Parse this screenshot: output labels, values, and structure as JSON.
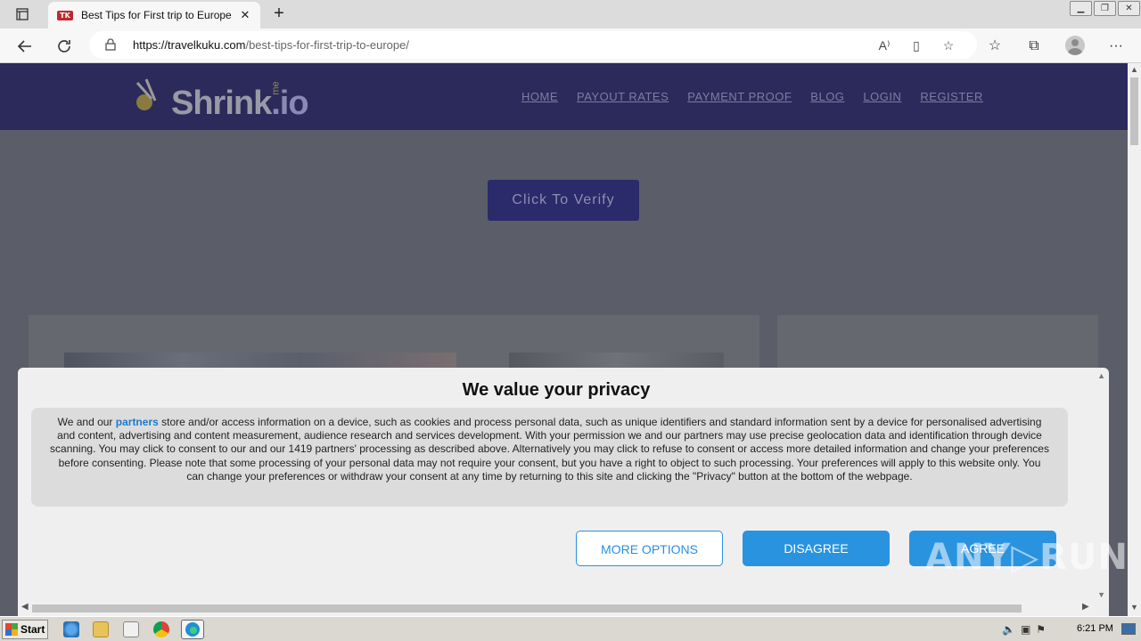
{
  "tab": {
    "favicon_text": "TK",
    "title": "Best Tips for First trip to Europe",
    "close": "✕"
  },
  "newtab": "+",
  "address": {
    "domain": "https://travelkuku.com",
    "path": "/best-tips-for-first-trip-to-europe/"
  },
  "site": {
    "logo_word": "Shrink",
    "logo_me": "me",
    "logo_tld": ".io",
    "menu": [
      "HOME",
      "PAYOUT RATES",
      "PAYMENT PROOF",
      "BLOG",
      "LOGIN",
      "REGISTER"
    ],
    "verify_button": "Click To Verify"
  },
  "consent": {
    "title": "We value your privacy",
    "text_before_link": "We and our ",
    "link": "partners",
    "text_after_link": " store and/or access information on a device, such as cookies and process personal data, such as unique identifiers and standard information sent by a device for personalised advertising and content, advertising and content measurement, audience research and services development. With your permission we and our partners may use precise geolocation data and identification through device scanning. You may click to consent to our and our 1419 partners' processing as described above. Alternatively you may click to refuse to consent or access more detailed information and change your preferences before consenting. Please note that some processing of your personal data may not require your consent, but you have a right to object to such processing. Your preferences will apply to this website only. You can change your preferences or withdraw your consent at any time by returning to this site and clicking the \"Privacy\" button at the bottom of the webpage.",
    "more_options": "MORE OPTIONS",
    "disagree": "DISAGREE",
    "agree": "AGREE"
  },
  "watermark": "ANY▷RUN",
  "taskbar": {
    "start": "Start",
    "time": "6:21 PM"
  }
}
